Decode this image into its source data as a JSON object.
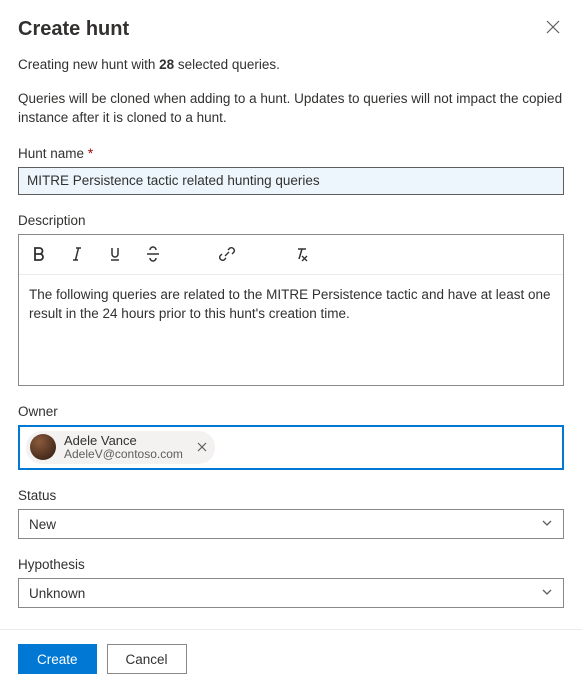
{
  "header": {
    "title": "Create hunt"
  },
  "info": {
    "line1_prefix": "Creating new hunt with ",
    "line1_count": "28",
    "line1_suffix": " selected queries.",
    "line2": "Queries will be cloned when adding to a hunt. Updates to queries will not impact the copied instance after it is cloned to a hunt."
  },
  "fields": {
    "hunt_name": {
      "label": "Hunt name",
      "required_marker": "*",
      "value": "MITRE Persistence tactic related hunting queries"
    },
    "description": {
      "label": "Description",
      "value": "The following queries are related to the MITRE Persistence tactic and have at least one result in the 24 hours prior to this hunt's creation time."
    },
    "owner": {
      "label": "Owner",
      "chip": {
        "name": "Adele Vance",
        "email": "AdeleV@contoso.com"
      }
    },
    "status": {
      "label": "Status",
      "value": "New"
    },
    "hypothesis": {
      "label": "Hypothesis",
      "value": "Unknown"
    }
  },
  "footer": {
    "create_label": "Create",
    "cancel_label": "Cancel"
  }
}
